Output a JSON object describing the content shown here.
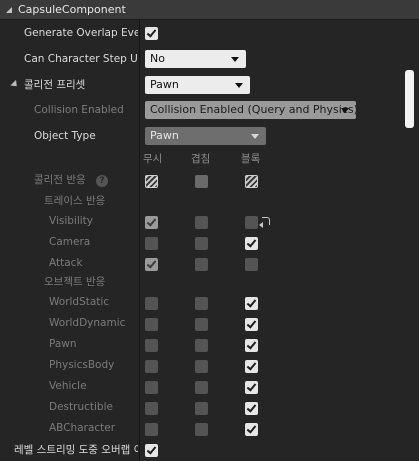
{
  "section": {
    "title": "CapsuleComponent"
  },
  "properties": {
    "generate_overlap": {
      "label": "Generate Overlap Event",
      "checked": true
    },
    "can_step_up": {
      "label": "Can Character Step Up",
      "value": "No"
    },
    "collision_preset": {
      "label": "콜리전 프리셋",
      "value": "Pawn"
    },
    "collision_enabled": {
      "label": "Collision Enabled",
      "value": "Collision Enabled (Query and Physics)"
    },
    "object_type": {
      "label": "Object Type",
      "value": "Pawn"
    },
    "level_streaming": {
      "label": "레벨 스트리밍 도중 오버랩 이벤트 생성",
      "checked": true
    }
  },
  "columns": {
    "ignore": "무시",
    "overlap": "겹침",
    "block": "블록"
  },
  "collision_response": {
    "label": "콜리전 반응",
    "help": "?"
  },
  "trace_header": "트레이스 반응",
  "object_header": "오브젝트 반응",
  "trace_rows": [
    {
      "label": "Visibility",
      "ignore": true,
      "overlap": false,
      "block": false,
      "reset": true
    },
    {
      "label": "Camera",
      "ignore": false,
      "overlap": false,
      "block": true,
      "reset": false
    },
    {
      "label": "Attack",
      "ignore": true,
      "overlap": false,
      "block": false,
      "reset": false
    }
  ],
  "object_rows": [
    {
      "label": "WorldStatic",
      "ignore": false,
      "overlap": false,
      "block": true
    },
    {
      "label": "WorldDynamic",
      "ignore": false,
      "overlap": false,
      "block": true
    },
    {
      "label": "Pawn",
      "ignore": false,
      "overlap": false,
      "block": true
    },
    {
      "label": "PhysicsBody",
      "ignore": false,
      "overlap": false,
      "block": true
    },
    {
      "label": "Vehicle",
      "ignore": false,
      "overlap": false,
      "block": true
    },
    {
      "label": "Destructible",
      "ignore": false,
      "overlap": false,
      "block": true
    },
    {
      "label": "ABCharacter",
      "ignore": false,
      "overlap": false,
      "block": true
    }
  ]
}
